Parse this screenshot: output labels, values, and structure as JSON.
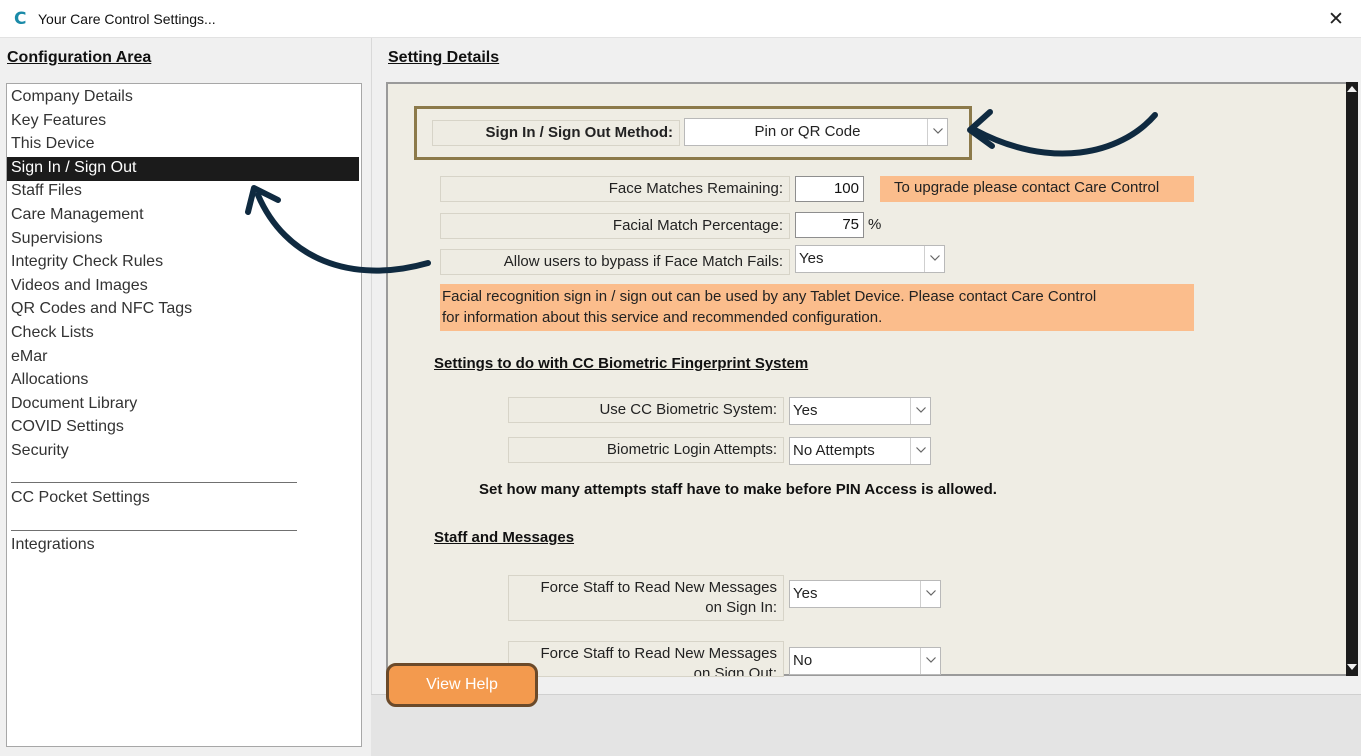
{
  "window": {
    "title": "Your Care Control Settings...",
    "app_icon_glyph": "C",
    "close_glyph": "✕"
  },
  "left_pane": {
    "title": "Configuration Area",
    "items": [
      "Company Details",
      "Key Features",
      "This Device",
      "Sign In / Sign Out",
      "Staff Files",
      "Care Management",
      "Supervisions",
      "Integrity Check Rules",
      "Videos and Images",
      "QR Codes and NFC Tags",
      "Check Lists",
      "eMar",
      "Allocations",
      "Document Library",
      "COVID Settings",
      "Security"
    ],
    "selected_item": "Sign In / Sign Out",
    "extra_items": [
      "CC Pocket Settings",
      "Integrations"
    ]
  },
  "details": {
    "title": "Setting Details",
    "sign_method": {
      "label": "Sign In / Sign Out Method:",
      "value": "Pin or QR Code"
    },
    "face_matches": {
      "label": "Face Matches Remaining:",
      "value": "100",
      "upgrade_note": "To upgrade please contact Care Control"
    },
    "facial_percentage": {
      "label": "Facial Match Percentage:",
      "value": "75",
      "suffix": "%"
    },
    "bypass": {
      "label": "Allow users to bypass if Face Match Fails:",
      "value": "Yes"
    },
    "facial_note": {
      "line1": "Facial recognition sign in / sign out can be used by any Tablet Device.  Please contact Care Control",
      "line2": "for information about this service and recommended configuration."
    },
    "biometric_section": {
      "title": "Settings to do with CC Biometric Fingerprint System",
      "use_system": {
        "label": "Use CC Biometric System:",
        "value": "Yes"
      },
      "login_attempts": {
        "label": "Biometric Login Attempts:",
        "value": "No Attempts"
      },
      "help": "Set how many attempts staff have to make before PIN Access is allowed."
    },
    "staff_section": {
      "title": "Staff and Messages",
      "read_sign_in": {
        "label_line1": "Force Staff to Read New Messages",
        "label_line2": "on Sign In:",
        "value": "Yes"
      },
      "read_sign_out": {
        "label_line1": "Force Staff to Read New Messages",
        "label_line2": "on Sign Out:",
        "value": "No"
      }
    }
  },
  "footer": {
    "help_button": "View Help"
  },
  "colors": {
    "accent_orange": "#f39a4e",
    "note_orange": "#fbbd8c",
    "highlight_border": "#8c7a4a",
    "arrow_navy": "#0f2a40",
    "selected_bg": "#1b1b1b"
  }
}
